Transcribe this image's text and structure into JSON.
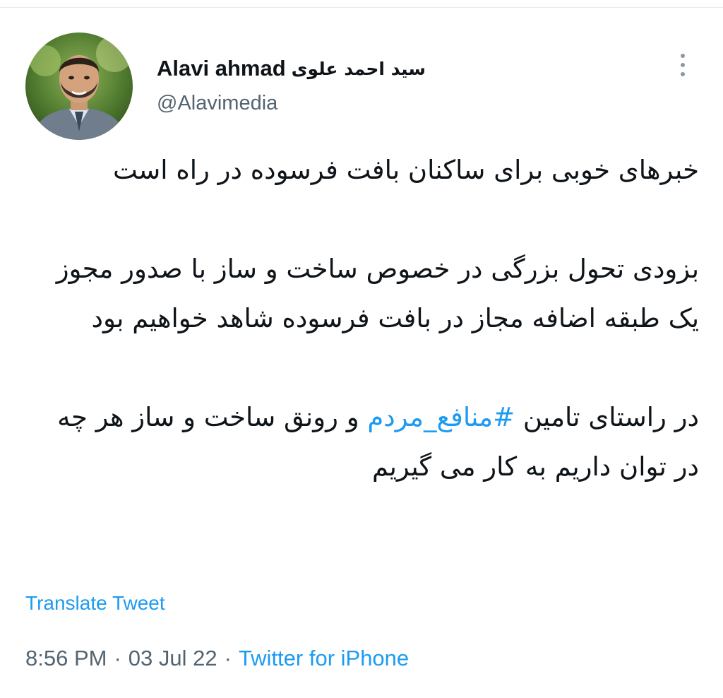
{
  "tweet": {
    "author": {
      "name_latin": "Alavi ahmad",
      "name_fa": "سید احمد علوی",
      "handle": "@Alavimedia"
    },
    "text": {
      "p1": "خبرهای خوبی برای ساکنان بافت فرسوده در راه است",
      "p2": "بزودی تحول بزرگی در خصوص ساخت و ساز با صدور مجوز یک طبقه اضافه مجاز در بافت فرسوده شاهد خواهیم بود",
      "p3_before": "در راستای تامین",
      "hashtag": "#منافع_مردم",
      "p3_after": "و رونق ساخت و ساز هر چه در توان داریم به کار می گیریم"
    },
    "translate_label": "Translate Tweet",
    "time": "8:56 PM",
    "date": "03 Jul 22",
    "separator": "·",
    "source": "Twitter for iPhone"
  },
  "icons": {
    "more": "more-vertical-icon",
    "avatar": "profile-photo"
  },
  "colors": {
    "link": "#1d9bf0",
    "text": "#0f1419",
    "secondary": "#536471"
  }
}
